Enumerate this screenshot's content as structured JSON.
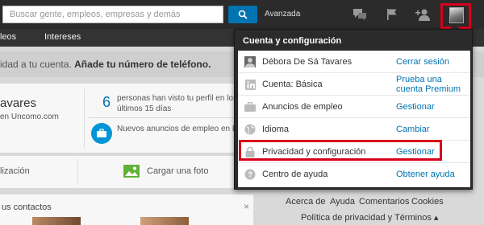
{
  "header": {
    "search_placeholder": "Buscar gente, empleos, empresas y demás",
    "advanced_label": "Avanzada"
  },
  "nav": {
    "items": [
      "leos",
      "Intereses"
    ]
  },
  "notice": {
    "text": "idad a tu cuenta.",
    "cta": "Añade tu número de teléfono."
  },
  "profile_card": {
    "name": "avares",
    "subline": "en Uncomo.com",
    "views_count": "6",
    "views_text": "personas han visto tu perfil en los últimos 15 días",
    "jobs_text": "Nuevos anuncios de empleo en Exotica, Evercom: Comunicac",
    "action_left": "lización",
    "action_photo": "Cargar una foto"
  },
  "contacts": {
    "title": "us contactos",
    "close": "×"
  },
  "footer": {
    "links": [
      "Acerca de",
      "Ayuda",
      "Comentarios",
      "Cookies"
    ],
    "privacy": "Política de privacidad y Términos ▴"
  },
  "menu": {
    "title": "Cuenta y configuración",
    "items": [
      {
        "icon": "avatar-icon",
        "label": "Débora De Sá Tavares",
        "link": "Cerrar sesión"
      },
      {
        "icon": "linkedin-icon",
        "label": "Cuenta: Básica",
        "link": "Prueba una cuenta Premium"
      },
      {
        "icon": "briefcase-icon",
        "label": "Anuncios de empleo",
        "link": "Gestionar"
      },
      {
        "icon": "globe-icon",
        "label": "Idioma",
        "link": "Cambiar"
      },
      {
        "icon": "lock-icon",
        "label": "Privacidad y configuración",
        "link": "Gestionar"
      },
      {
        "icon": "help-icon",
        "label": "Centro de ayuda",
        "link": "Obtener ayuda"
      }
    ]
  },
  "colors": {
    "accent": "#0073b1",
    "highlight": "#d6001c",
    "topbar": "#2b2b2b"
  }
}
